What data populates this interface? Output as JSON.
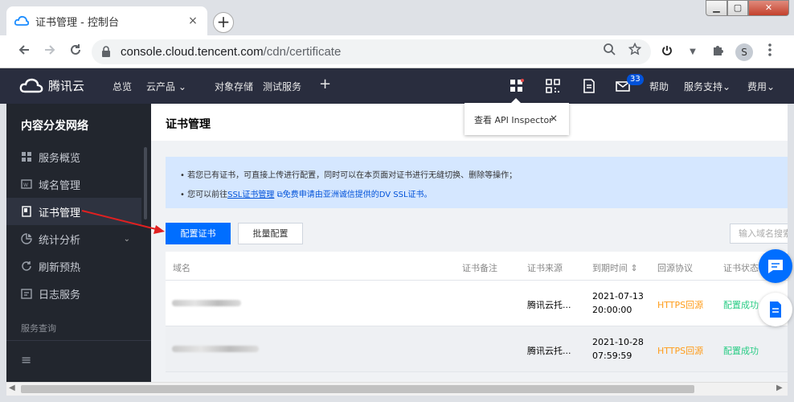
{
  "browser": {
    "tab_title": "证书管理 - 控制台",
    "tab_close": "×",
    "new_tab": "+",
    "url_host": "console.cloud.tencent.com",
    "url_path": "/cdn/certificate",
    "profile_initial": "S",
    "window_controls": {
      "minimize": "▁",
      "maximize": "▢",
      "close": "✕"
    }
  },
  "topnav": {
    "brand": "腾讯云",
    "items": [
      "总览",
      "云产品",
      "对象存储",
      "测试服务",
      "+"
    ],
    "mail_count": "33",
    "right_items": [
      "帮助",
      "服务支持",
      "费用"
    ],
    "brand_color": "#292d3e"
  },
  "tooltip": {
    "text": "查看 API Inspector",
    "close": "×"
  },
  "sidebar": {
    "title": "内容分发网络",
    "items": [
      {
        "label": "服务概览",
        "icon": "grid-icon"
      },
      {
        "label": "域名管理",
        "icon": "www-icon"
      },
      {
        "label": "证书管理",
        "icon": "certificate-icon",
        "active": true
      },
      {
        "label": "统计分析",
        "icon": "chart-icon",
        "arrow": "⌄"
      },
      {
        "label": "刷新预热",
        "icon": "refresh-icon"
      },
      {
        "label": "日志服务",
        "icon": "log-icon"
      }
    ],
    "section": "服务查询",
    "bottom_icon": "≡"
  },
  "main": {
    "page_title": "证书管理",
    "notice": {
      "line1": "若您已有证书，可直接上传进行配置，同时可以在本页面对证书进行无缝切换、删除等操作；",
      "line2_pre": "您可以前往",
      "line2_link": "SSL证书管理",
      "line2_link2": "免费申请由亚洲诚信提供的DV SSL证书。",
      "bullet": "•"
    },
    "buttons": {
      "configure": "配置证书",
      "batch": "批量配置"
    },
    "search_placeholder": "输入域名搜索",
    "table": {
      "headers": [
        "域名",
        "证书备注",
        "证书来源",
        "到期时间",
        "回源协议",
        "证书状态"
      ],
      "sort_icon": "⇕",
      "rows": [
        {
          "source": "腾讯云托...",
          "expiry_date": "2021-07-13",
          "expiry_time": "20:00:00",
          "protocol": "HTTPS回源",
          "status": "配置成功"
        },
        {
          "source": "腾讯云托...",
          "expiry_date": "2021-10-28",
          "expiry_time": "07:59:59",
          "protocol": "HTTPS回源",
          "status": "配置成功"
        }
      ]
    }
  },
  "colors": {
    "primary": "#006eff",
    "orange": "#ff9c19",
    "green": "#29cc85",
    "sidebar_bg": "#22262e",
    "annotation_arrow": "#e02020"
  }
}
